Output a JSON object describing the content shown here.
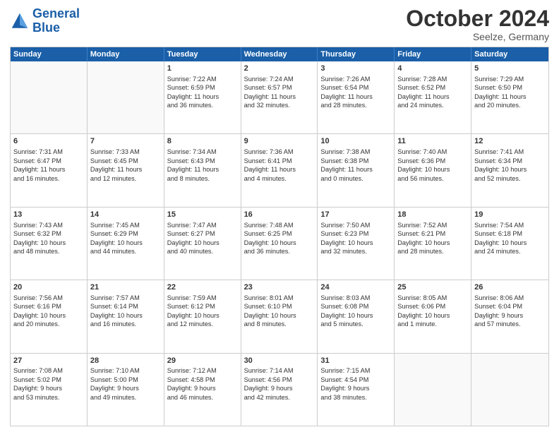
{
  "logo": {
    "line1": "General",
    "line2": "Blue"
  },
  "title": "October 2024",
  "location": "Seelze, Germany",
  "days": [
    "Sunday",
    "Monday",
    "Tuesday",
    "Wednesday",
    "Thursday",
    "Friday",
    "Saturday"
  ],
  "rows": [
    [
      {
        "day": "",
        "info": "",
        "empty": true
      },
      {
        "day": "",
        "info": "",
        "empty": true
      },
      {
        "day": "1",
        "info": "Sunrise: 7:22 AM\nSunset: 6:59 PM\nDaylight: 11 hours\nand 36 minutes.",
        "empty": false
      },
      {
        "day": "2",
        "info": "Sunrise: 7:24 AM\nSunset: 6:57 PM\nDaylight: 11 hours\nand 32 minutes.",
        "empty": false
      },
      {
        "day": "3",
        "info": "Sunrise: 7:26 AM\nSunset: 6:54 PM\nDaylight: 11 hours\nand 28 minutes.",
        "empty": false
      },
      {
        "day": "4",
        "info": "Sunrise: 7:28 AM\nSunset: 6:52 PM\nDaylight: 11 hours\nand 24 minutes.",
        "empty": false
      },
      {
        "day": "5",
        "info": "Sunrise: 7:29 AM\nSunset: 6:50 PM\nDaylight: 11 hours\nand 20 minutes.",
        "empty": false
      }
    ],
    [
      {
        "day": "6",
        "info": "Sunrise: 7:31 AM\nSunset: 6:47 PM\nDaylight: 11 hours\nand 16 minutes.",
        "empty": false
      },
      {
        "day": "7",
        "info": "Sunrise: 7:33 AM\nSunset: 6:45 PM\nDaylight: 11 hours\nand 12 minutes.",
        "empty": false
      },
      {
        "day": "8",
        "info": "Sunrise: 7:34 AM\nSunset: 6:43 PM\nDaylight: 11 hours\nand 8 minutes.",
        "empty": false
      },
      {
        "day": "9",
        "info": "Sunrise: 7:36 AM\nSunset: 6:41 PM\nDaylight: 11 hours\nand 4 minutes.",
        "empty": false
      },
      {
        "day": "10",
        "info": "Sunrise: 7:38 AM\nSunset: 6:38 PM\nDaylight: 11 hours\nand 0 minutes.",
        "empty": false
      },
      {
        "day": "11",
        "info": "Sunrise: 7:40 AM\nSunset: 6:36 PM\nDaylight: 10 hours\nand 56 minutes.",
        "empty": false
      },
      {
        "day": "12",
        "info": "Sunrise: 7:41 AM\nSunset: 6:34 PM\nDaylight: 10 hours\nand 52 minutes.",
        "empty": false
      }
    ],
    [
      {
        "day": "13",
        "info": "Sunrise: 7:43 AM\nSunset: 6:32 PM\nDaylight: 10 hours\nand 48 minutes.",
        "empty": false
      },
      {
        "day": "14",
        "info": "Sunrise: 7:45 AM\nSunset: 6:29 PM\nDaylight: 10 hours\nand 44 minutes.",
        "empty": false
      },
      {
        "day": "15",
        "info": "Sunrise: 7:47 AM\nSunset: 6:27 PM\nDaylight: 10 hours\nand 40 minutes.",
        "empty": false
      },
      {
        "day": "16",
        "info": "Sunrise: 7:48 AM\nSunset: 6:25 PM\nDaylight: 10 hours\nand 36 minutes.",
        "empty": false
      },
      {
        "day": "17",
        "info": "Sunrise: 7:50 AM\nSunset: 6:23 PM\nDaylight: 10 hours\nand 32 minutes.",
        "empty": false
      },
      {
        "day": "18",
        "info": "Sunrise: 7:52 AM\nSunset: 6:21 PM\nDaylight: 10 hours\nand 28 minutes.",
        "empty": false
      },
      {
        "day": "19",
        "info": "Sunrise: 7:54 AM\nSunset: 6:18 PM\nDaylight: 10 hours\nand 24 minutes.",
        "empty": false
      }
    ],
    [
      {
        "day": "20",
        "info": "Sunrise: 7:56 AM\nSunset: 6:16 PM\nDaylight: 10 hours\nand 20 minutes.",
        "empty": false
      },
      {
        "day": "21",
        "info": "Sunrise: 7:57 AM\nSunset: 6:14 PM\nDaylight: 10 hours\nand 16 minutes.",
        "empty": false
      },
      {
        "day": "22",
        "info": "Sunrise: 7:59 AM\nSunset: 6:12 PM\nDaylight: 10 hours\nand 12 minutes.",
        "empty": false
      },
      {
        "day": "23",
        "info": "Sunrise: 8:01 AM\nSunset: 6:10 PM\nDaylight: 10 hours\nand 8 minutes.",
        "empty": false
      },
      {
        "day": "24",
        "info": "Sunrise: 8:03 AM\nSunset: 6:08 PM\nDaylight: 10 hours\nand 5 minutes.",
        "empty": false
      },
      {
        "day": "25",
        "info": "Sunrise: 8:05 AM\nSunset: 6:06 PM\nDaylight: 10 hours\nand 1 minute.",
        "empty": false
      },
      {
        "day": "26",
        "info": "Sunrise: 8:06 AM\nSunset: 6:04 PM\nDaylight: 9 hours\nand 57 minutes.",
        "empty": false
      }
    ],
    [
      {
        "day": "27",
        "info": "Sunrise: 7:08 AM\nSunset: 5:02 PM\nDaylight: 9 hours\nand 53 minutes.",
        "empty": false
      },
      {
        "day": "28",
        "info": "Sunrise: 7:10 AM\nSunset: 5:00 PM\nDaylight: 9 hours\nand 49 minutes.",
        "empty": false
      },
      {
        "day": "29",
        "info": "Sunrise: 7:12 AM\nSunset: 4:58 PM\nDaylight: 9 hours\nand 46 minutes.",
        "empty": false
      },
      {
        "day": "30",
        "info": "Sunrise: 7:14 AM\nSunset: 4:56 PM\nDaylight: 9 hours\nand 42 minutes.",
        "empty": false
      },
      {
        "day": "31",
        "info": "Sunrise: 7:15 AM\nSunset: 4:54 PM\nDaylight: 9 hours\nand 38 minutes.",
        "empty": false
      },
      {
        "day": "",
        "info": "",
        "empty": true
      },
      {
        "day": "",
        "info": "",
        "empty": true
      }
    ]
  ]
}
